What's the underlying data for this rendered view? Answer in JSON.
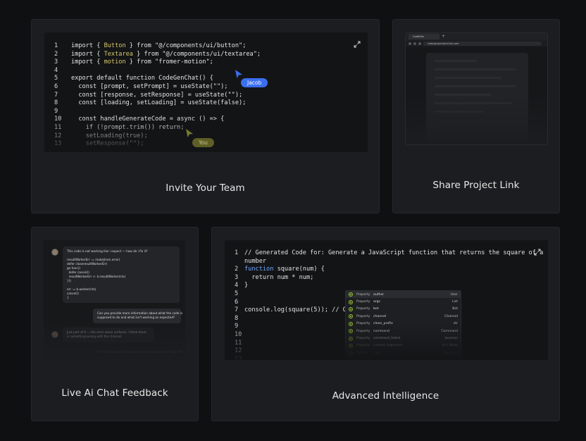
{
  "cards": {
    "invite": {
      "title": "Invite Your Team",
      "code_lines": [
        {
          "n": "1",
          "parts": [
            [
              "import { ",
              "kw"
            ],
            [
              "Button",
              "hl"
            ],
            [
              " } from \"@/components/ui/button\";",
              "kw"
            ]
          ]
        },
        {
          "n": "2",
          "parts": [
            [
              "import { ",
              "kw"
            ],
            [
              "Textarea",
              "hl"
            ],
            [
              " } from \"@/components/ui/textarea\";",
              "kw"
            ]
          ]
        },
        {
          "n": "3",
          "parts": [
            [
              "import { ",
              "kw"
            ],
            [
              "motion",
              "hl"
            ],
            [
              " } from \"fromer-motion\";",
              "kw"
            ]
          ]
        },
        {
          "n": "4",
          "parts": []
        },
        {
          "n": "5",
          "parts": [
            [
              "export default function CodeGenChat() {",
              "kw"
            ]
          ]
        },
        {
          "n": "6",
          "parts": [
            [
              "  const [prompt, setPrompt] = useState(\"\");",
              "kw"
            ]
          ]
        },
        {
          "n": "7",
          "parts": [
            [
              "  const [response, setResponse] = useState(\"\");",
              "kw"
            ]
          ]
        },
        {
          "n": "8",
          "parts": [
            [
              "  const [loading, setLoading] = useState(false);",
              "kw"
            ]
          ]
        },
        {
          "n": "9",
          "parts": []
        },
        {
          "n": "10",
          "parts": [
            [
              "  const handleGenerateCode = async () => {",
              "kw"
            ]
          ]
        },
        {
          "n": "11",
          "parts": [
            [
              "    if (!prompt.trim()) return;",
              "kw"
            ]
          ]
        },
        {
          "n": "12",
          "parts": [
            [
              "    setLoading(true);",
              "kw"
            ]
          ]
        },
        {
          "n": "13",
          "parts": [
            [
              "    setResponse(\"\");",
              "kw"
            ]
          ]
        }
      ],
      "cursors": [
        {
          "label": "Jacob",
          "color": "#3b6ff0"
        },
        {
          "label": "You",
          "color": "#7a7a2e"
        }
      ]
    },
    "share": {
      "title": "Share Project Link",
      "tab_label": "CodeGen",
      "url": "codegen/productlink.com"
    },
    "chat": {
      "title": "Live Ai Chat Feedback",
      "msg1": "This code is not working like i expect — how do i fix it?\n\nresultWorkerErr := makeJ/rain.error)\ndefer closeresultWorkerErr)\ngo func()\n  defer cancel()\n  resultWorkerErr <- b.resultWorker(ctx)\n}()\n\nerr := b.worker(ctx)\ncancel()\n}",
      "msg2": "Can you provide more information about what the code is\nsupposed to do and what isn't working as expected?",
      "msg3": "Just part of it — the error never surfaces. I think there\nis something wrong with the channel.",
      "msg4": "To fix the issue, you should use the defined error channel"
    },
    "advanced": {
      "title": "Advanced Intelligence",
      "code_lines": [
        {
          "n": "1",
          "text": "// Generated Code for: Generate a JavaScript function that returns the square of a"
        },
        {
          "n": "",
          "text": "number"
        },
        {
          "n": "2",
          "text": "function square(num) {"
        },
        {
          "n": "3",
          "text": "  return num * num;"
        },
        {
          "n": "4",
          "text": "}"
        },
        {
          "n": "5",
          "text": ""
        },
        {
          "n": "6",
          "text": ""
        },
        {
          "n": "7",
          "text": "console.log(square(5)); // Out"
        },
        {
          "n": "8",
          "text": ""
        },
        {
          "n": "9",
          "text": ""
        },
        {
          "n": "10",
          "text": ""
        },
        {
          "n": "11",
          "text": ""
        },
        {
          "n": "12",
          "text": ""
        },
        {
          "n": "13",
          "text": ""
        }
      ],
      "autocomplete": [
        {
          "kind": "Property",
          "name": "author",
          "type": "User"
        },
        {
          "kind": "Property",
          "name": "args",
          "type": "List"
        },
        {
          "kind": "Property",
          "name": "bot",
          "type": "Bot"
        },
        {
          "kind": "Property",
          "name": "channel",
          "type": "Channel"
        },
        {
          "kind": "Property",
          "name": "clean_prefix",
          "type": "str"
        },
        {
          "kind": "Property",
          "name": "command",
          "type": "Command"
        },
        {
          "kind": "Property",
          "name": "command_failed",
          "type": "boolean"
        },
        {
          "kind": "Property",
          "name": "current_argument",
          "type": "str | None"
        },
        {
          "kind": "Method",
          "name": "send",
          "type": "Message"
        }
      ]
    }
  },
  "colors": {
    "accent_blue": "#3b6ff0",
    "accent_olive": "#7a7a2e",
    "success_green": "#9acd32"
  }
}
